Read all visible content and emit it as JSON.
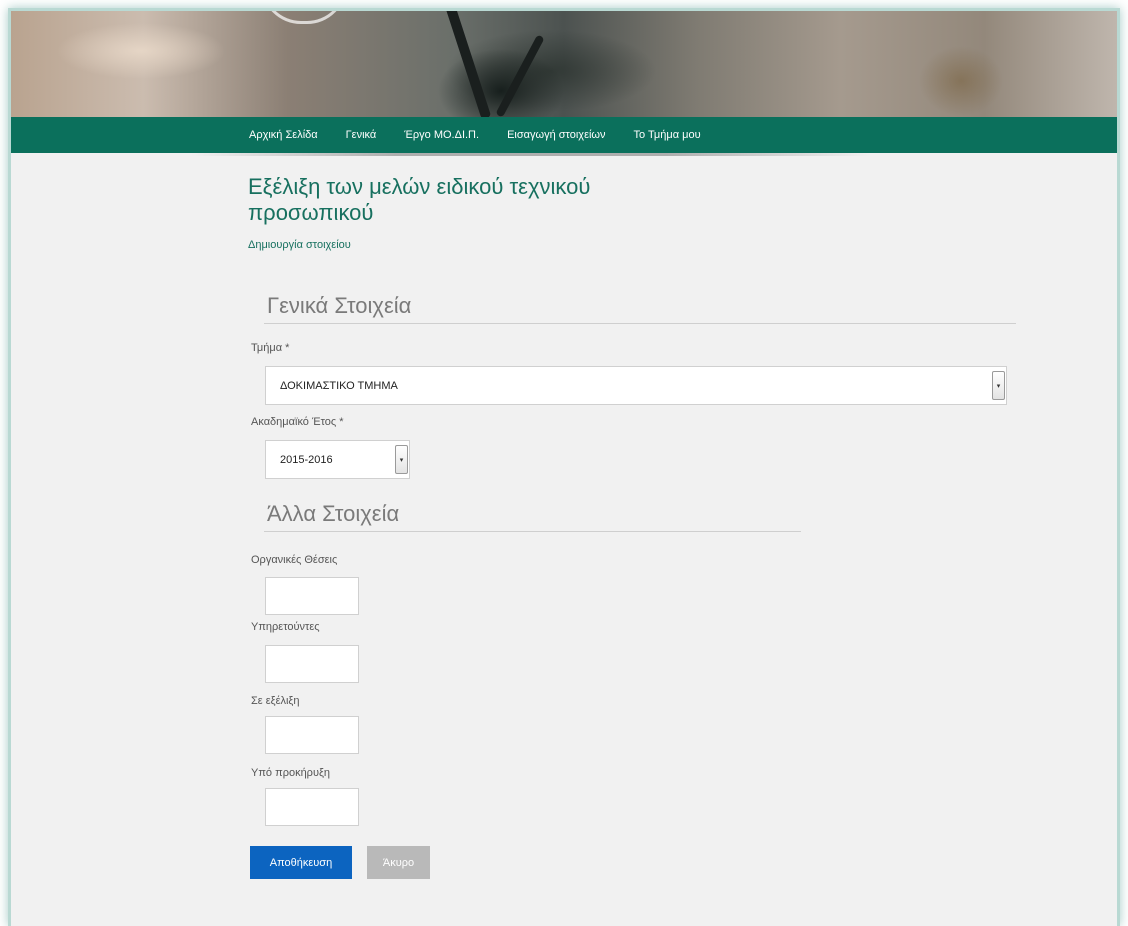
{
  "nav": {
    "items": [
      {
        "label": "Αρχική Σελίδα"
      },
      {
        "label": "Γενικά"
      },
      {
        "label": "Έργο ΜΟ.ΔΙ.Π."
      },
      {
        "label": "Εισαγωγή στοιχείων"
      },
      {
        "label": "Το Τμήμα μου"
      }
    ]
  },
  "page": {
    "title_line1": "Εξέλιξη των μελών ειδικού τεχνικού",
    "title_line2": "προσωπικού",
    "subtitle": "Δημιουργία στοιχείου"
  },
  "general_section": {
    "heading": "Γενικά Στοιχεία",
    "department_label": "Τμήμα *",
    "department_value": "ΔΟΚΙΜΑΣΤΙΚΟ ΤΜΗΜΑ",
    "year_label": "Ακαδημαϊκό Έτος *",
    "year_value": "2015-2016"
  },
  "other_section": {
    "heading": "Άλλα Στοιχεία",
    "fields": [
      {
        "label": "Οργανικές Θέσεις",
        "value": ""
      },
      {
        "label": "Υπηρετούντες",
        "value": ""
      },
      {
        "label": "Σε εξέλιξη",
        "value": ""
      },
      {
        "label": "Υπό προκήρυξη",
        "value": ""
      }
    ]
  },
  "actions": {
    "save_label": "Αποθήκευση",
    "cancel_label": "Άκυρο"
  },
  "colors": {
    "nav_bg": "#0b705c",
    "title": "#17705f",
    "save_button": "#0c64c0",
    "cancel_button": "#b9b9b9"
  },
  "icons": {
    "select_arrow": "chevron-down-icon"
  }
}
